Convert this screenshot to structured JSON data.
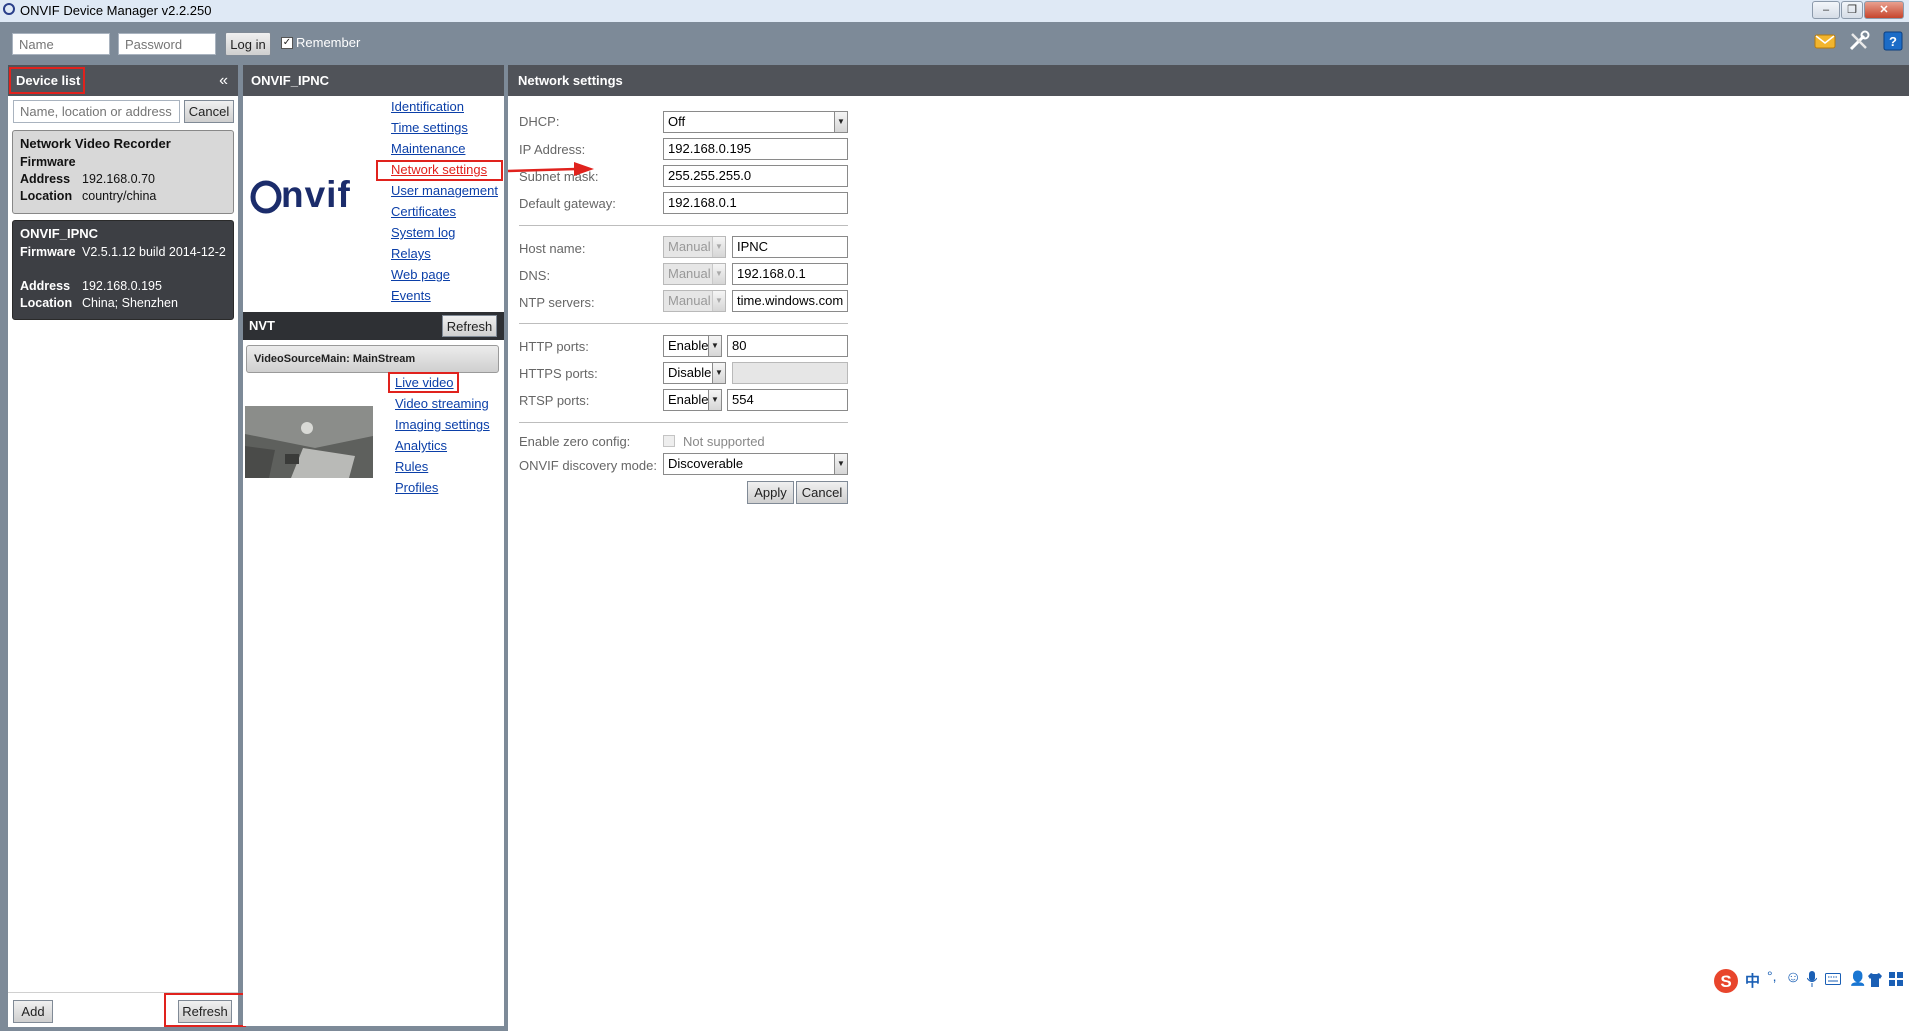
{
  "window": {
    "title": "ONVIF Device Manager v2.2.250",
    "controls": [
      "minimize",
      "restore",
      "close"
    ]
  },
  "login": {
    "name_placeholder": "Name",
    "password_placeholder": "Password",
    "login_label": "Log in",
    "remember_label": "Remember",
    "remember_checked": true,
    "toolbar_icons": [
      "messages-icon",
      "tools-icon",
      "help-icon"
    ]
  },
  "device_list": {
    "title": "Device list",
    "collapse_icon": "«",
    "search_placeholder": "Name, location or address",
    "cancel_label": "Cancel",
    "devices": [
      {
        "name": "Network Video Recorder",
        "firmware_label": "Firmware",
        "firmware": "",
        "address_label": "Address",
        "address": "192.168.0.70",
        "location_label": "Location",
        "location": "country/china",
        "selected": false
      },
      {
        "name": "ONVIF_IPNC",
        "firmware_label": "Firmware",
        "firmware": "V2.5.1.12 build 2014-12-2",
        "address_label": "Address",
        "address": "192.168.0.195",
        "location_label": "Location",
        "location": "China; Shenzhen",
        "selected": true
      }
    ],
    "add_label": "Add",
    "refresh_label": "Refresh"
  },
  "device_panel": {
    "title": "ONVIF_IPNC",
    "logo_text": "nvif",
    "menu": [
      "Identification",
      "Time settings",
      "Maintenance",
      "Network settings",
      "User management",
      "Certificates",
      "System log",
      "Relays",
      "Web page",
      "Events"
    ],
    "active_menu": "Network settings",
    "nvt_title": "NVT",
    "nvt_refresh_label": "Refresh",
    "stream_title": "VideoSourceMain: MainStream",
    "stream_menu": [
      "Live video",
      "Video streaming",
      "Imaging settings",
      "Analytics",
      "Rules",
      "Profiles"
    ]
  },
  "network_settings": {
    "title": "Network settings",
    "dhcp_label": "DHCP:",
    "dhcp_value": "Off",
    "ip_label": "IP Address:",
    "ip_value": "192.168.0.195",
    "subnet_label": "Subnet mask:",
    "subnet_value": "255.255.255.0",
    "gateway_label": "Default gateway:",
    "gateway_value": "192.168.0.1",
    "host_label": "Host name:",
    "host_mode": "Manual",
    "host_value": "IPNC",
    "dns_label": "DNS:",
    "dns_mode": "Manual",
    "dns_value": "192.168.0.1",
    "ntp_label": "NTP servers:",
    "ntp_mode": "Manual",
    "ntp_value": "time.windows.com",
    "http_label": "HTTP ports:",
    "http_mode": "Enable",
    "http_value": "80",
    "https_label": "HTTPS ports:",
    "https_mode": "Disable",
    "https_value": "",
    "rtsp_label": "RTSP ports:",
    "rtsp_mode": "Enable",
    "rtsp_value": "554",
    "zero_label": "Enable zero config:",
    "zero_value": "Not supported",
    "discovery_label": "ONVIF discovery mode:",
    "discovery_value": "Discoverable",
    "apply_label": "Apply",
    "cancel_label": "Cancel"
  },
  "tray": {
    "ime_text": "中",
    "icons": [
      "sogou-icon",
      "chinese-input-icon",
      "punctuation-icon",
      "emoji-icon",
      "microphone-icon",
      "keyboard-icon",
      "user-icon",
      "shirt-icon",
      "grid-icon"
    ]
  },
  "colors": {
    "background": "#7d8a98",
    "panel_header": "#505359",
    "highlight_red": "#e0221d",
    "link_blue": "#0b3fa8",
    "active_link": "#e0221d"
  }
}
